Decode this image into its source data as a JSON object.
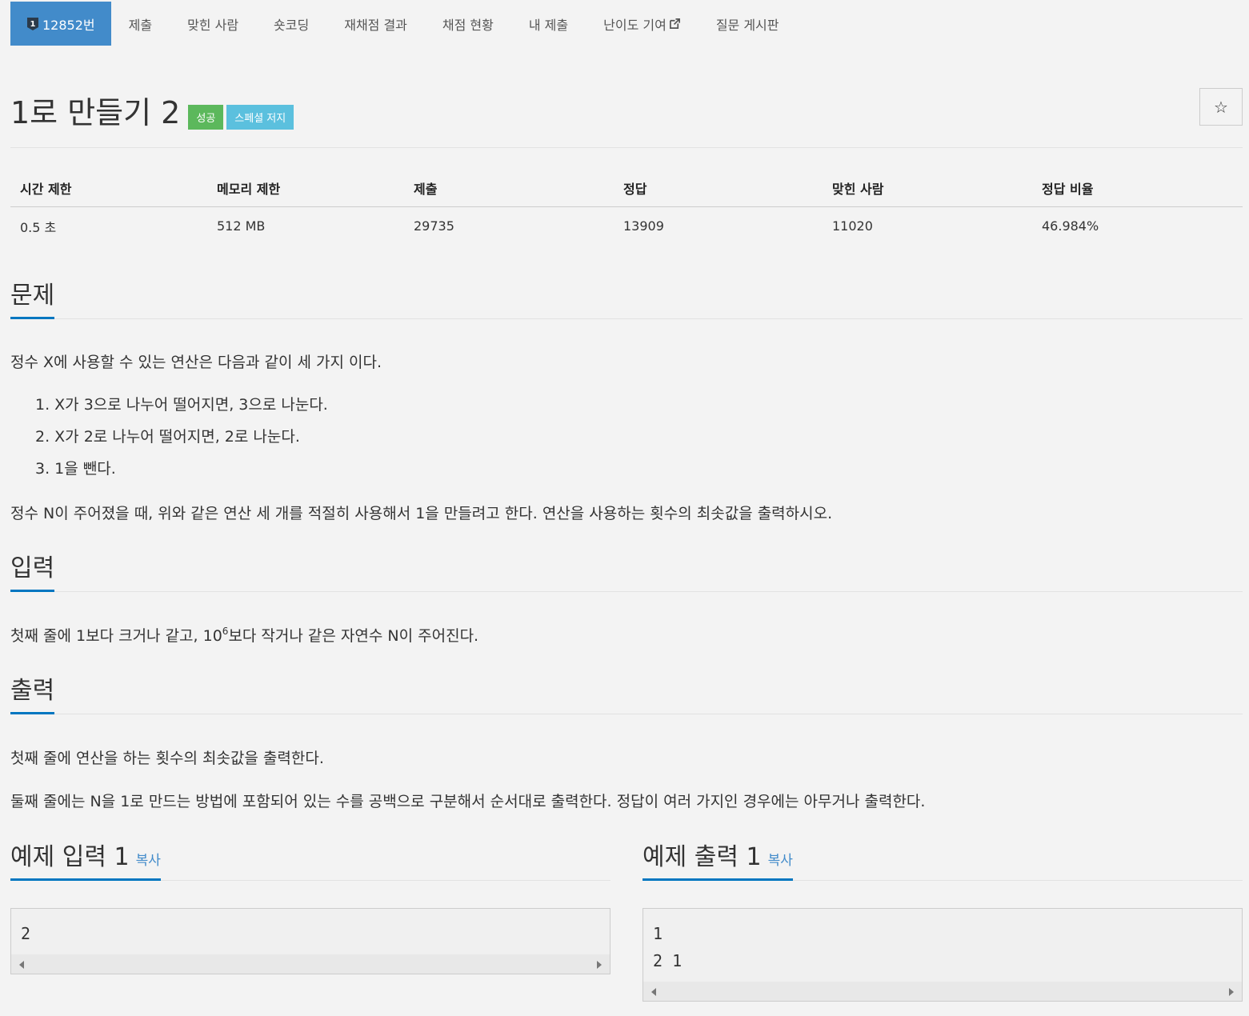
{
  "nav": {
    "problem_number": "12852번",
    "items": [
      "제출",
      "맞힌 사람",
      "숏코딩",
      "재채점 결과",
      "채점 현황",
      "내 제출",
      "난이도 기여",
      "질문 게시판"
    ]
  },
  "title": "1로 만들기 2",
  "labels": {
    "success": "성공",
    "special": "스페셜 저지"
  },
  "star_icon": "☆",
  "stats": {
    "headers": [
      "시간 제한",
      "메모리 제한",
      "제출",
      "정답",
      "맞힌 사람",
      "정답 비율"
    ],
    "values": [
      "0.5 초",
      "512 MB",
      "29735",
      "13909",
      "11020",
      "46.984%"
    ]
  },
  "problem": {
    "heading": "문제",
    "intro": "정수 X에 사용할 수 있는 연산은 다음과 같이 세 가지 이다.",
    "ops": [
      "1. X가 3으로 나누어 떨어지면, 3으로 나눈다.",
      "2. X가 2로 나누어 떨어지면, 2로 나눈다.",
      "3. 1을 뺀다."
    ],
    "body": "정수 N이 주어졌을 때, 위와 같은 연산 세 개를 적절히 사용해서 1을 만들려고 한다. 연산을 사용하는 횟수의 최솟값을 출력하시오."
  },
  "input": {
    "heading": "입력",
    "text_before": "첫째 줄에 1보다 크거나 같고, 10",
    "sup": "6",
    "text_after": "보다 작거나 같은 자연수 N이 주어진다."
  },
  "output": {
    "heading": "출력",
    "line1": "첫째 줄에 연산을 하는 횟수의 최솟값을 출력한다.",
    "line2": "둘째 줄에는 N을 1로 만드는 방법에 포함되어 있는 수를 공백으로 구분해서 순서대로 출력한다. 정답이 여러 가지인 경우에는 아무거나 출력한다."
  },
  "samples": {
    "input_heading": "예제 입력 1",
    "output_heading": "예제 출력 1",
    "copy_label": "복사",
    "input_text": "2",
    "output_text": "1\n2 1"
  }
}
